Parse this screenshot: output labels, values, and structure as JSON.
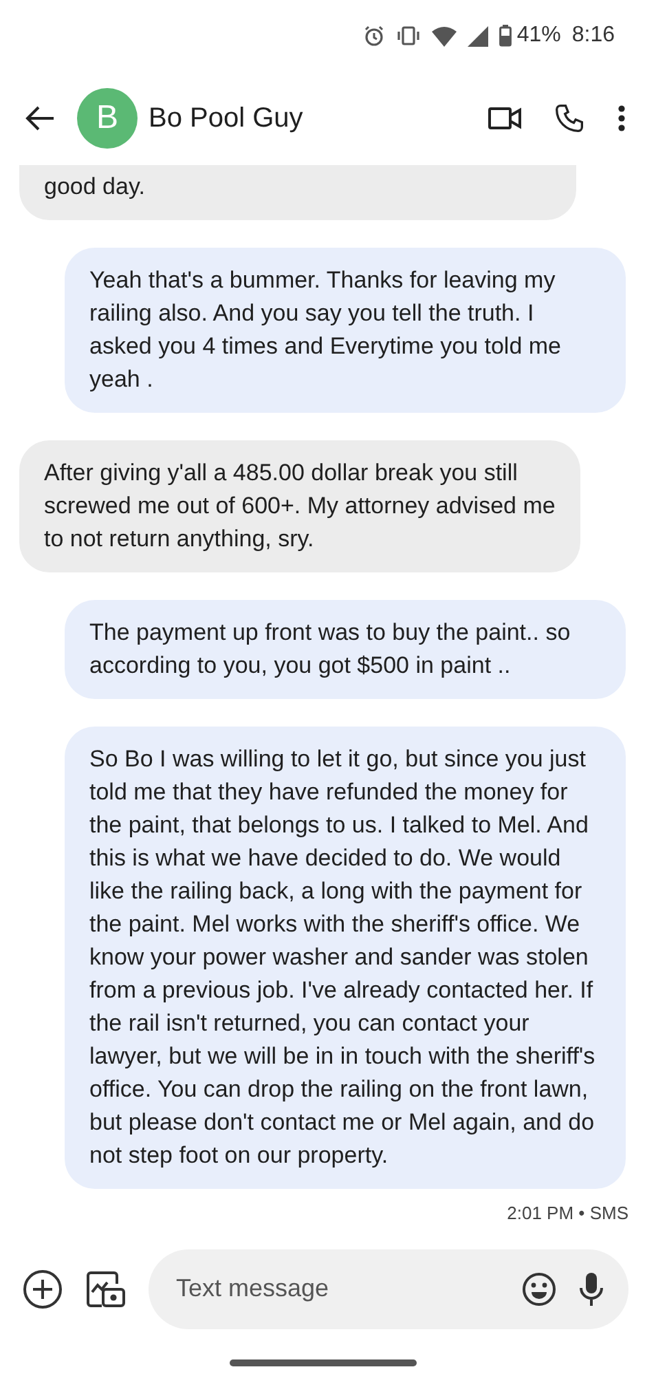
{
  "status_bar": {
    "battery": "41%",
    "time": "8:16"
  },
  "header": {
    "avatar_letter": "B",
    "contact": "Bo Pool Guy"
  },
  "messages": [
    {
      "kind": "incoming",
      "text": "good day.",
      "partial": true
    },
    {
      "kind": "outgoing",
      "text": "Yeah that's a bummer. Thanks for leaving my railing also. And you say you tell the truth. I asked you 4 times and Everytime you told me yeah ."
    },
    {
      "kind": "incoming",
      "text": "After giving y'all a 485.00 dollar break you still screwed me out of 600+. My attorney advised me to not return anything, sry."
    },
    {
      "kind": "outgoing",
      "text": "The payment up front was to buy the paint.. so according to you, you got $500 in paint .."
    },
    {
      "kind": "outgoing",
      "text": "So Bo I was willing to let it go, but since you just told me that they have refunded the money for the paint, that belongs to us. I talked to Mel. And this is what we have decided to do. We would like the railing back, a long with the payment for the paint. Mel works with the sheriff's office. We know your power washer and sander was stolen from a previous job. I've already contacted her. If the rail isn't returned, you can contact your lawyer, but we will be in in touch with the sheriff's office.  You can drop the railing on the front lawn, but please don't contact me or Mel again, and do not step foot on our property."
    }
  ],
  "timestamp": "2:01 PM • SMS",
  "composer": {
    "placeholder": "Text message"
  }
}
